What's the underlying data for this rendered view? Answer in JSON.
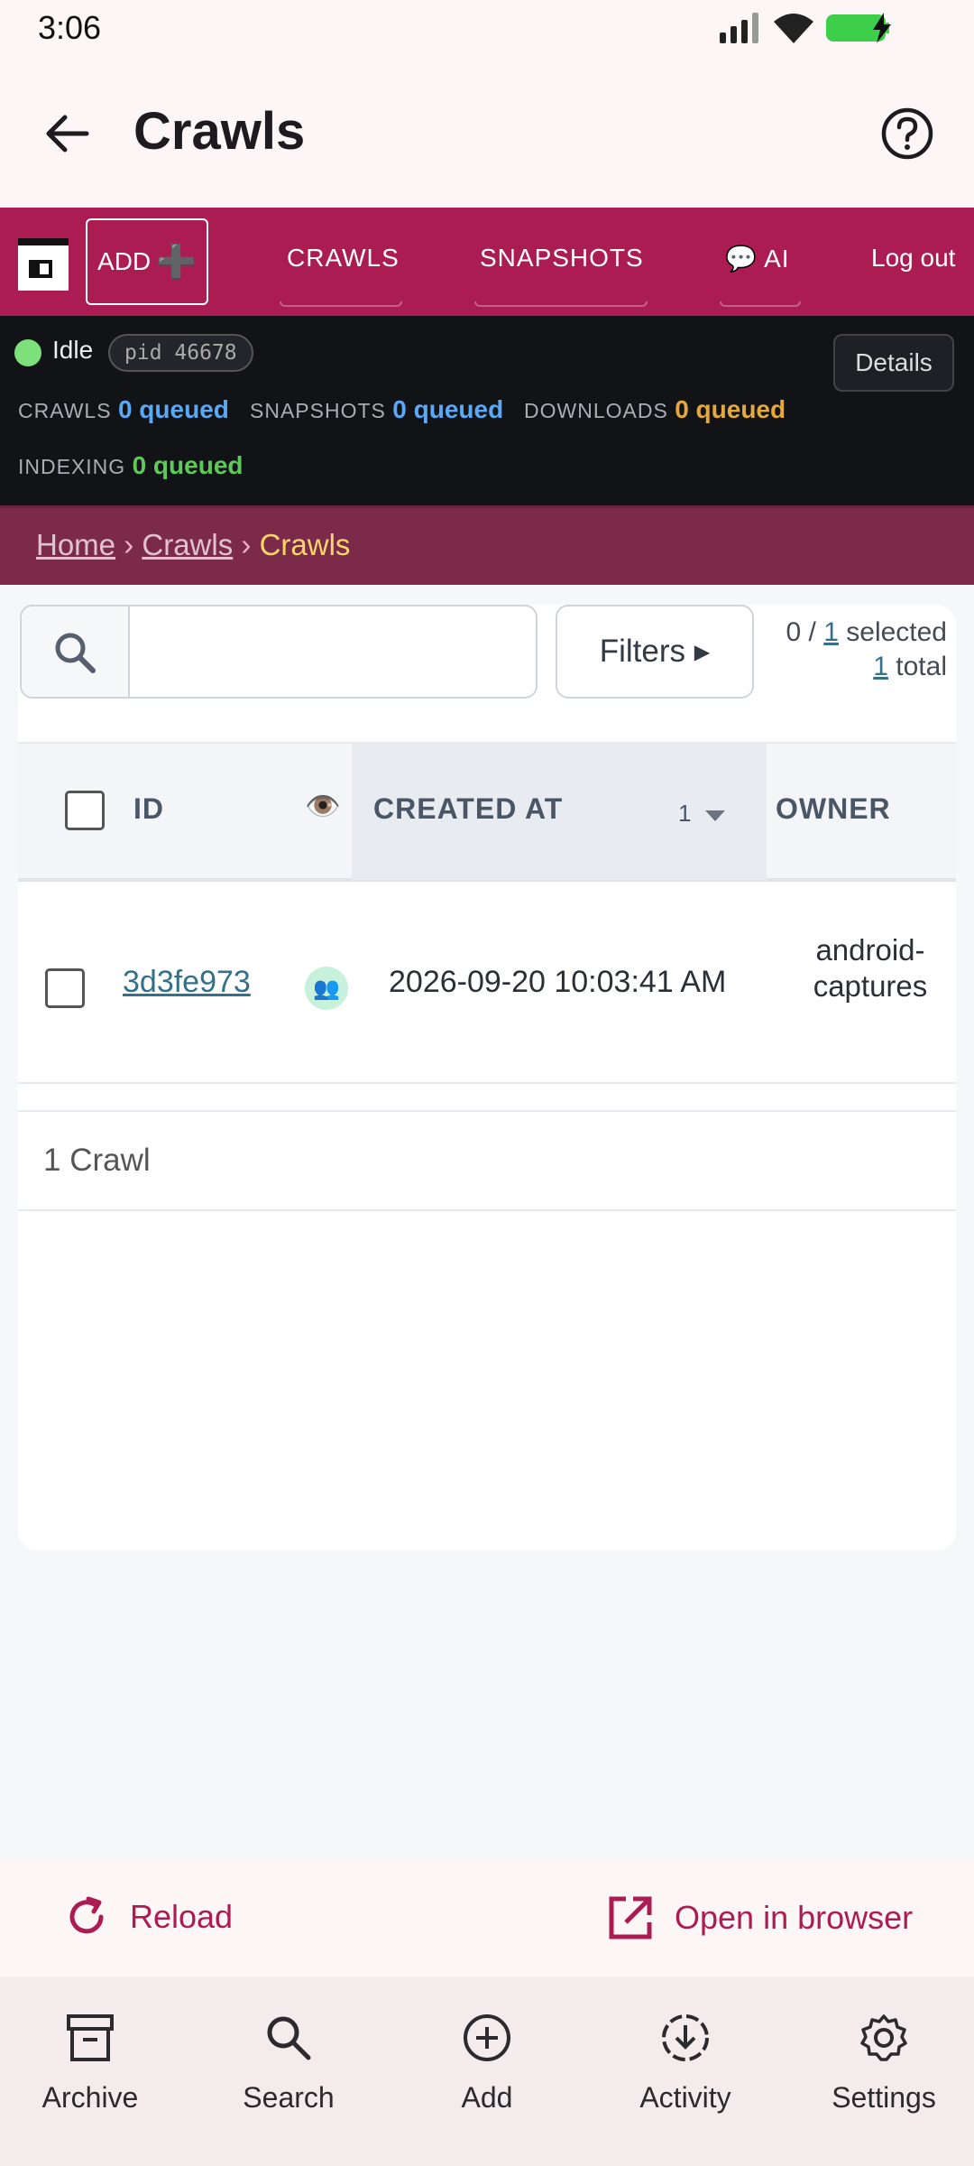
{
  "status_bar": {
    "time": "3:06"
  },
  "app_bar": {
    "title": "Crawls"
  },
  "web_nav": {
    "add_label": "ADD",
    "add_icon": "➕",
    "items": [
      {
        "label": "CRAWLS"
      },
      {
        "label": "SNAPSHOTS"
      },
      {
        "label": "💬 AI"
      },
      {
        "label": "Log out"
      }
    ]
  },
  "orchestrator": {
    "state": "Idle",
    "pid": "pid 46678",
    "details_label": "Details",
    "queues": [
      {
        "label": "CRAWLS",
        "value": "0 queued",
        "color": "#5aa9f5"
      },
      {
        "label": "SNAPSHOTS",
        "value": "0 queued",
        "color": "#5aa9f5"
      },
      {
        "label": "DOWNLOADS",
        "value": "0 queued",
        "color": "#e3a93a"
      },
      {
        "label": "INDEXING",
        "value": "0 queued",
        "color": "#5ec95a"
      }
    ]
  },
  "breadcrumb": {
    "home": "Home",
    "sep": "›",
    "section": "Crawls",
    "current": "Crawls"
  },
  "toolbar": {
    "search_value": "",
    "filters_label": "Filters ▸",
    "selected_prefix": "0 / ",
    "selected_count": "1",
    "selected_suffix": " selected",
    "total_count": "1",
    "total_suffix": " total"
  },
  "table": {
    "columns": {
      "id": "ID",
      "created_at": "CREATED AT",
      "sort_index": "1",
      "owner": "OWNER"
    },
    "rows": [
      {
        "id": "3d3fe973",
        "badge": "👥",
        "created_at": "2026-09-20 10:03:41 AM",
        "owner_line1": "android-",
        "owner_line2": "captures"
      }
    ],
    "footer": "1 Crawl"
  },
  "actions": {
    "reload": "Reload",
    "open_browser": "Open in browser"
  },
  "bottom_nav": [
    {
      "label": "Archive"
    },
    {
      "label": "Search"
    },
    {
      "label": "Add"
    },
    {
      "label": "Activity"
    },
    {
      "label": "Settings"
    }
  ],
  "colors": {
    "brand": "#ab1d52",
    "link": "#35708a",
    "crumb_current": "#fdd76a"
  }
}
